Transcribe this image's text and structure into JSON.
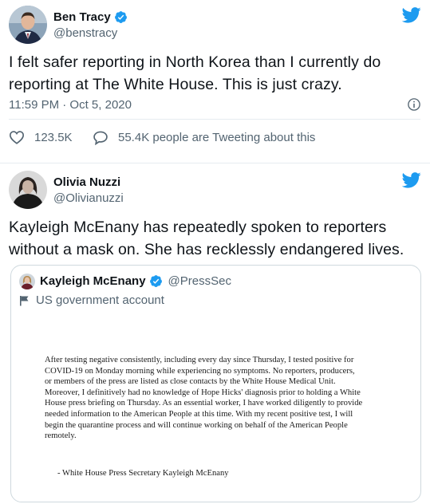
{
  "tweets": [
    {
      "author_name": "Ben Tracy",
      "handle": "@benstracy",
      "text": "I felt safer reporting in North Korea than I currently do reporting at The White House. This is just crazy.",
      "timestamp": "11:59 PM · Oct 5, 2020",
      "likes": "123.5K",
      "tweeting": "55.4K people are Tweeting about this"
    },
    {
      "author_name": "Olivia Nuzzi",
      "handle": "@Olivianuzzi",
      "text": "Kayleigh McEnany has repeatedly spoken to reporters without a mask on. She has recklessly endangered lives.",
      "quote": {
        "author_name": "Kayleigh McEnany",
        "handle": "@PressSec",
        "account_label": "US government account",
        "statement": "After testing negative consistently, including every day since Thursday, I tested positive for COVID-19 on Monday morning while experiencing no symptoms.  No reporters, producers, or members of the press are listed as close contacts by the White House Medical Unit. Moreover, I definitively had no knowledge of Hope Hicks' diagnosis prior to holding a White House press briefing on Thursday. As an essential worker, I have worked diligently to provide needed information to the American People at this time. With my recent positive test, I will begin the quarantine process and will continue working on behalf of the American People remotely.",
        "statement_signature": "-     White House Press Secretary Kayleigh McEnany"
      }
    }
  ],
  "colors": {
    "twitter_blue": "#1d9bf0",
    "secondary_text": "#536471",
    "primary_text": "#0f1419",
    "border": "#cfd9de"
  },
  "icons": {
    "logo": "twitter-bird-icon",
    "verified": "verified-badge-icon",
    "like": "heart-icon",
    "reply": "speech-bubble-icon",
    "info": "info-icon",
    "government": "flag-icon"
  }
}
